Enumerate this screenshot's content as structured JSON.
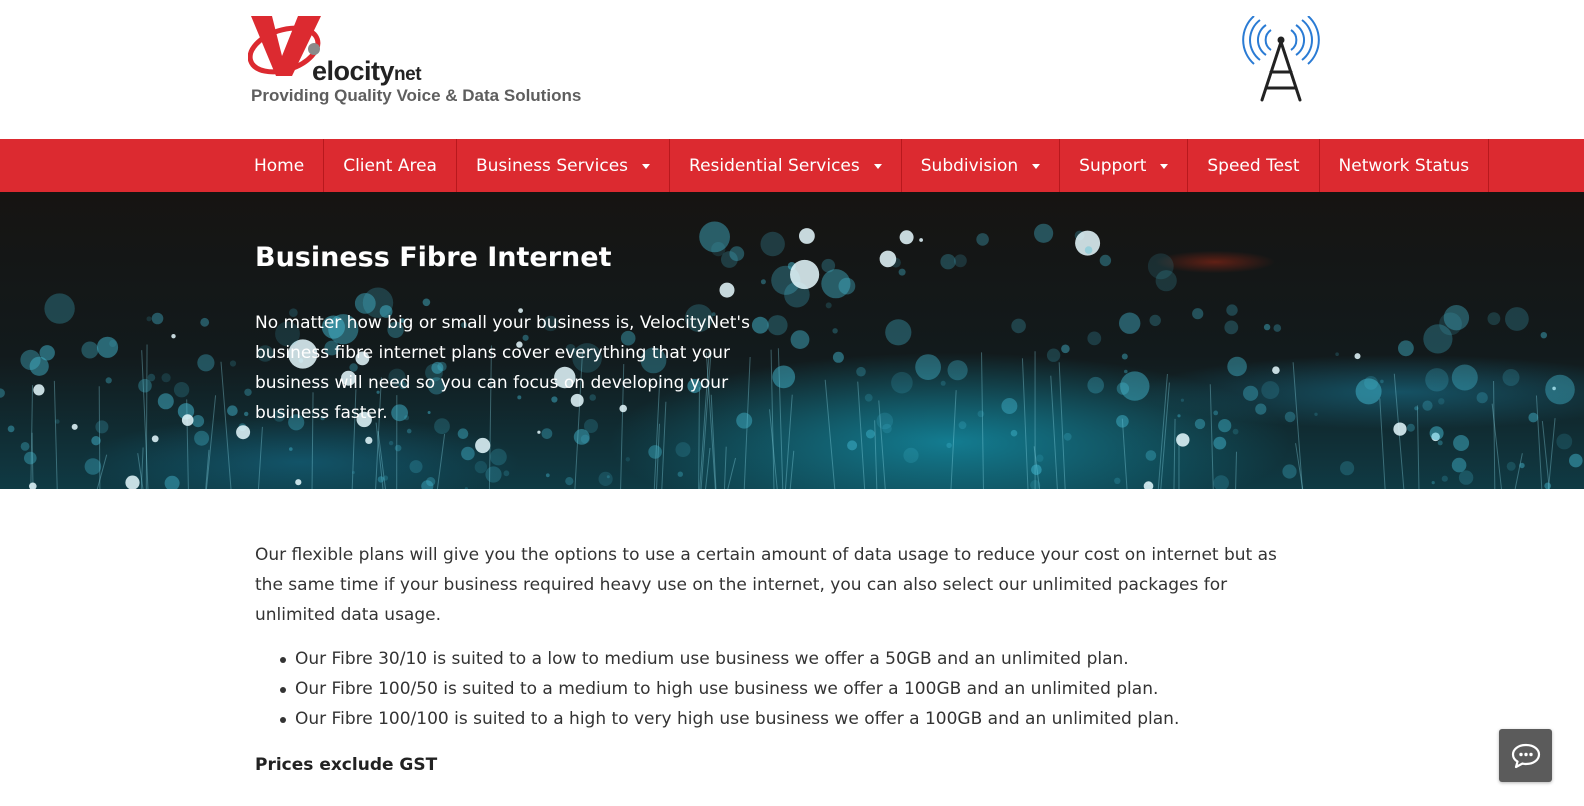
{
  "brand": {
    "logo_word": "elocity",
    "logo_suffix": "net",
    "tagline": "Providing Quality Voice & Data Solutions",
    "brand_color": "#dc2a30"
  },
  "nav": {
    "items": [
      {
        "label": "Home",
        "dropdown": false
      },
      {
        "label": "Client Area",
        "dropdown": false
      },
      {
        "label": "Business Services",
        "dropdown": true
      },
      {
        "label": "Residential Services",
        "dropdown": true
      },
      {
        "label": "Subdivision",
        "dropdown": true
      },
      {
        "label": "Support",
        "dropdown": true
      },
      {
        "label": "Speed Test",
        "dropdown": false
      },
      {
        "label": "Network Status",
        "dropdown": false
      }
    ]
  },
  "hero": {
    "title": "Business Fibre Internet",
    "text": "No matter how big or small your business is, VelocityNet's business fibre internet plans cover everything that your business will need so you can focus on developing your business faster."
  },
  "content": {
    "intro": "Our flexible plans will give you the options to use a certain amount of data usage to reduce your cost on internet but as the same time if your business required heavy use on the internet, you can also select our unlimited packages for unlimited data usage.",
    "plans": [
      "Our Fibre 30/10 is suited to a low to medium use business we offer a 50GB and an unlimited plan.",
      "Our Fibre 100/50 is suited to a medium to high use business we offer a 100GB and an unlimited plan.",
      "Our Fibre 100/100 is suited to a high to very high use business we offer a 100GB and an unlimited plan."
    ],
    "gst_note": "Prices exclude GST"
  },
  "icons": {
    "tower": "radio-tower-icon",
    "chat": "chat-icon",
    "caret": "caret-down-icon"
  }
}
